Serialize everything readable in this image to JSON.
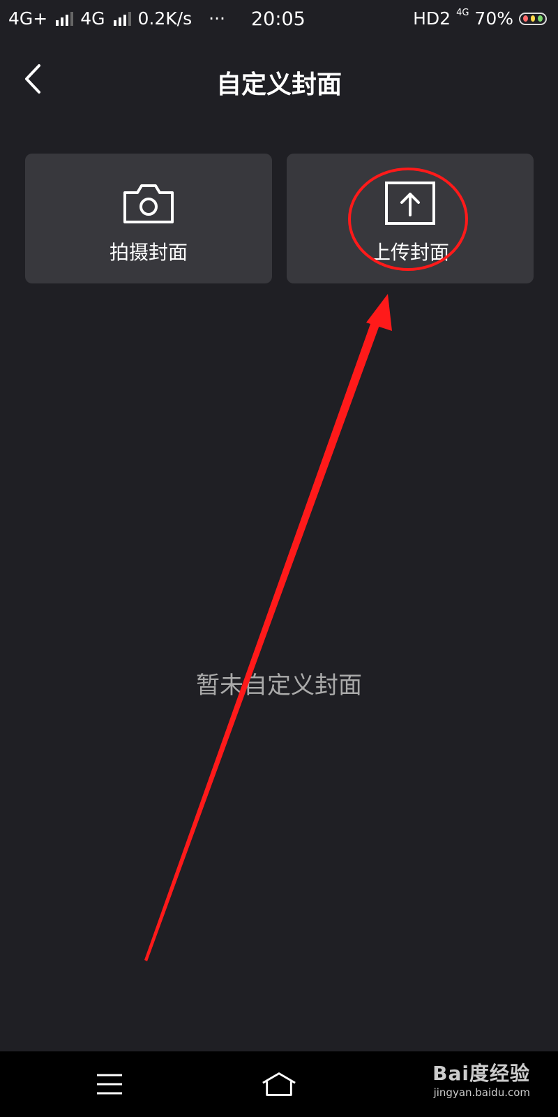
{
  "status_bar": {
    "network1": "4G+",
    "network2": "4G",
    "speed": "0.2K/s",
    "more": "···",
    "time": "20:05",
    "hd": "HD2",
    "network_small": "4G",
    "battery": "70%"
  },
  "header": {
    "title": "自定义封面"
  },
  "options": {
    "take_cover": "拍摄封面",
    "upload_cover": "上传封面"
  },
  "empty_state": "暂未自定义封面",
  "watermark": {
    "logo": "Bai度经验",
    "url": "jingyan.baidu.com"
  },
  "colors": {
    "background": "#1f1f24",
    "card": "#38383d",
    "annotation": "#ff1a1a"
  },
  "icons": {
    "back": "chevron-left-icon",
    "camera": "camera-icon",
    "upload": "upload-icon",
    "menu": "menu-icon",
    "home": "home-icon"
  }
}
